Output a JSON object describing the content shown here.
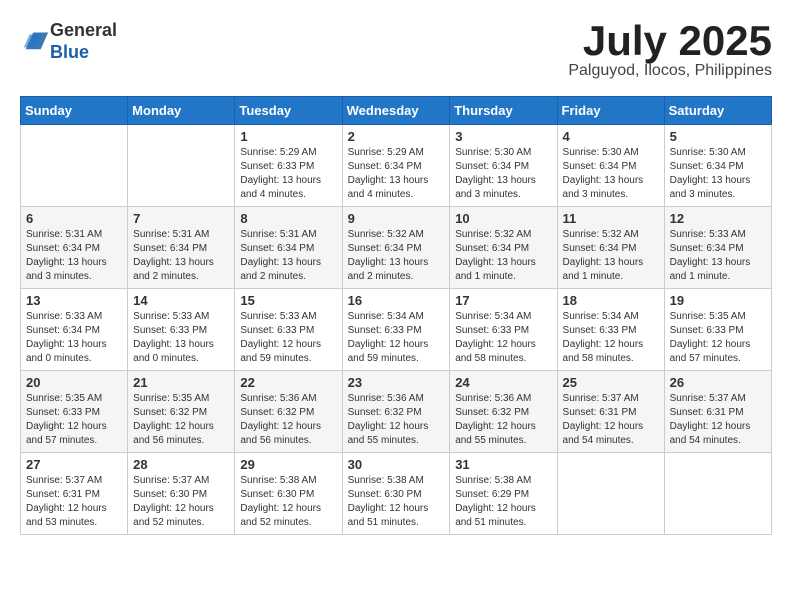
{
  "logo": {
    "general": "General",
    "blue": "Blue"
  },
  "header": {
    "month": "July 2025",
    "location": "Palguyod, Ilocos, Philippines"
  },
  "weekdays": [
    "Sunday",
    "Monday",
    "Tuesday",
    "Wednesday",
    "Thursday",
    "Friday",
    "Saturday"
  ],
  "weeks": [
    [
      null,
      null,
      {
        "day": 1,
        "sunrise": "5:29 AM",
        "sunset": "6:33 PM",
        "daylight": "13 hours and 4 minutes."
      },
      {
        "day": 2,
        "sunrise": "5:29 AM",
        "sunset": "6:34 PM",
        "daylight": "13 hours and 4 minutes."
      },
      {
        "day": 3,
        "sunrise": "5:30 AM",
        "sunset": "6:34 PM",
        "daylight": "13 hours and 3 minutes."
      },
      {
        "day": 4,
        "sunrise": "5:30 AM",
        "sunset": "6:34 PM",
        "daylight": "13 hours and 3 minutes."
      },
      {
        "day": 5,
        "sunrise": "5:30 AM",
        "sunset": "6:34 PM",
        "daylight": "13 hours and 3 minutes."
      }
    ],
    [
      {
        "day": 6,
        "sunrise": "5:31 AM",
        "sunset": "6:34 PM",
        "daylight": "13 hours and 3 minutes."
      },
      {
        "day": 7,
        "sunrise": "5:31 AM",
        "sunset": "6:34 PM",
        "daylight": "13 hours and 2 minutes."
      },
      {
        "day": 8,
        "sunrise": "5:31 AM",
        "sunset": "6:34 PM",
        "daylight": "13 hours and 2 minutes."
      },
      {
        "day": 9,
        "sunrise": "5:32 AM",
        "sunset": "6:34 PM",
        "daylight": "13 hours and 2 minutes."
      },
      {
        "day": 10,
        "sunrise": "5:32 AM",
        "sunset": "6:34 PM",
        "daylight": "13 hours and 1 minute."
      },
      {
        "day": 11,
        "sunrise": "5:32 AM",
        "sunset": "6:34 PM",
        "daylight": "13 hours and 1 minute."
      },
      {
        "day": 12,
        "sunrise": "5:33 AM",
        "sunset": "6:34 PM",
        "daylight": "13 hours and 1 minute."
      }
    ],
    [
      {
        "day": 13,
        "sunrise": "5:33 AM",
        "sunset": "6:34 PM",
        "daylight": "13 hours and 0 minutes."
      },
      {
        "day": 14,
        "sunrise": "5:33 AM",
        "sunset": "6:33 PM",
        "daylight": "13 hours and 0 minutes."
      },
      {
        "day": 15,
        "sunrise": "5:33 AM",
        "sunset": "6:33 PM",
        "daylight": "12 hours and 59 minutes."
      },
      {
        "day": 16,
        "sunrise": "5:34 AM",
        "sunset": "6:33 PM",
        "daylight": "12 hours and 59 minutes."
      },
      {
        "day": 17,
        "sunrise": "5:34 AM",
        "sunset": "6:33 PM",
        "daylight": "12 hours and 58 minutes."
      },
      {
        "day": 18,
        "sunrise": "5:34 AM",
        "sunset": "6:33 PM",
        "daylight": "12 hours and 58 minutes."
      },
      {
        "day": 19,
        "sunrise": "5:35 AM",
        "sunset": "6:33 PM",
        "daylight": "12 hours and 57 minutes."
      }
    ],
    [
      {
        "day": 20,
        "sunrise": "5:35 AM",
        "sunset": "6:33 PM",
        "daylight": "12 hours and 57 minutes."
      },
      {
        "day": 21,
        "sunrise": "5:35 AM",
        "sunset": "6:32 PM",
        "daylight": "12 hours and 56 minutes."
      },
      {
        "day": 22,
        "sunrise": "5:36 AM",
        "sunset": "6:32 PM",
        "daylight": "12 hours and 56 minutes."
      },
      {
        "day": 23,
        "sunrise": "5:36 AM",
        "sunset": "6:32 PM",
        "daylight": "12 hours and 55 minutes."
      },
      {
        "day": 24,
        "sunrise": "5:36 AM",
        "sunset": "6:32 PM",
        "daylight": "12 hours and 55 minutes."
      },
      {
        "day": 25,
        "sunrise": "5:37 AM",
        "sunset": "6:31 PM",
        "daylight": "12 hours and 54 minutes."
      },
      {
        "day": 26,
        "sunrise": "5:37 AM",
        "sunset": "6:31 PM",
        "daylight": "12 hours and 54 minutes."
      }
    ],
    [
      {
        "day": 27,
        "sunrise": "5:37 AM",
        "sunset": "6:31 PM",
        "daylight": "12 hours and 53 minutes."
      },
      {
        "day": 28,
        "sunrise": "5:37 AM",
        "sunset": "6:30 PM",
        "daylight": "12 hours and 52 minutes."
      },
      {
        "day": 29,
        "sunrise": "5:38 AM",
        "sunset": "6:30 PM",
        "daylight": "12 hours and 52 minutes."
      },
      {
        "day": 30,
        "sunrise": "5:38 AM",
        "sunset": "6:30 PM",
        "daylight": "12 hours and 51 minutes."
      },
      {
        "day": 31,
        "sunrise": "5:38 AM",
        "sunset": "6:29 PM",
        "daylight": "12 hours and 51 minutes."
      },
      null,
      null
    ]
  ]
}
